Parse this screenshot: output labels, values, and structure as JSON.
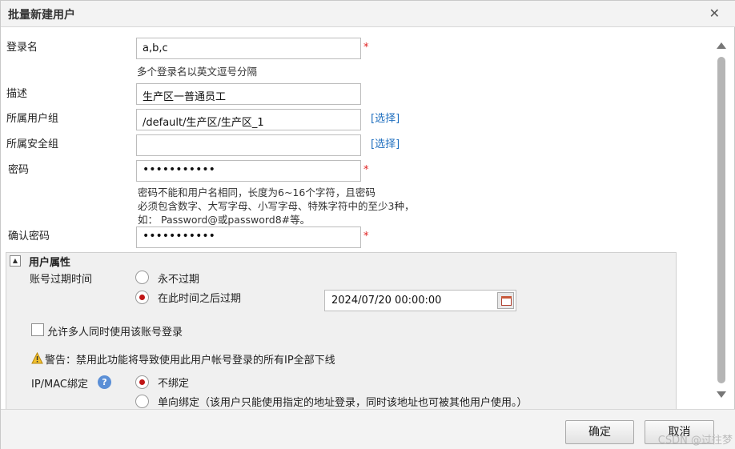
{
  "dialog": {
    "title": "批量新建用户",
    "close_icon": "close-icon"
  },
  "form": {
    "login_name": {
      "label": "登录名",
      "value": "a,b,c",
      "required": "*",
      "hint": "多个登录名以英文逗号分隔"
    },
    "description": {
      "label": "描述",
      "value": "生产区一普通员工"
    },
    "user_group": {
      "label": "所属用户组",
      "value": "/default/生产区/生产区_1",
      "select_link": "[选择]"
    },
    "security_group": {
      "label": "所属安全组",
      "value": "",
      "select_link": "[选择]"
    },
    "password": {
      "label": "密码",
      "value": "•••••••••••",
      "required": "*",
      "hint_lines": [
        "密码不能和用户名相同，长度为6~16个字符，且密码",
        "必须包含数字、大写字母、小写字母、特殊字符中的至少3种，",
        "如：  Password@或password8#等。"
      ]
    },
    "confirm_password": {
      "label": "确认密码",
      "value": "•••••••••••",
      "required": "*"
    }
  },
  "user_attributes": {
    "section_title": "用户属性",
    "toggle_glyph": "▲",
    "expiry": {
      "label": "账号过期时间",
      "options": [
        {
          "label": "永不过期",
          "selected": false
        },
        {
          "label": "在此时间之后过期",
          "selected": true
        }
      ],
      "date_value": "2024/07/20 00:00:00"
    },
    "multi_login": {
      "label": "允许多人同时使用该账号登录",
      "checked": false
    },
    "warning": {
      "icon": "warning-icon",
      "text": "警告：禁用此功能将导致使用此用户帐号登录的所有IP全部下线"
    },
    "ip_mac": {
      "label": "IP/MAC绑定",
      "help_glyph": "?",
      "options": [
        {
          "label": "不绑定",
          "selected": true
        },
        {
          "label": "单向绑定（该用户只能使用指定的地址登录，同时该地址也可被其他用户使用。）",
          "selected": false
        }
      ]
    }
  },
  "footer": {
    "confirm_label": "确定",
    "cancel_label": "取消",
    "watermark": "CSDN @过往梦"
  },
  "colors": {
    "required": "#e02020",
    "link": "#1f6fbf",
    "radio_selected": "#c01515"
  }
}
